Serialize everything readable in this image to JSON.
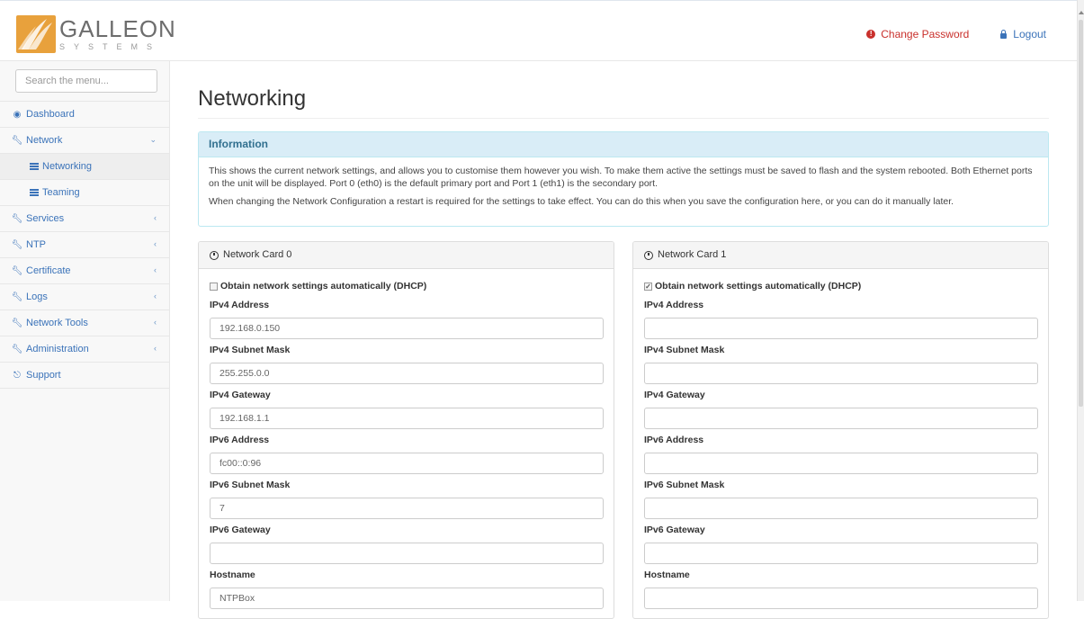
{
  "brand": {
    "name": "GALLEON",
    "sub": "SYSTEMS"
  },
  "header": {
    "change_password": "Change Password",
    "logout": "Logout"
  },
  "sidebar": {
    "search_placeholder": "Search the menu...",
    "items": [
      {
        "label": "Dashboard",
        "icon": "dashboard-icon"
      },
      {
        "label": "Network",
        "icon": "wrench-icon",
        "expanded": true
      },
      {
        "label": "Networking",
        "icon": "list-icon",
        "active": true
      },
      {
        "label": "Teaming",
        "icon": "list-icon"
      },
      {
        "label": "Services",
        "icon": "wrench-icon"
      },
      {
        "label": "NTP",
        "icon": "wrench-icon"
      },
      {
        "label": "Certificate",
        "icon": "wrench-icon"
      },
      {
        "label": "Logs",
        "icon": "wrench-icon"
      },
      {
        "label": "Network Tools",
        "icon": "wrench-icon"
      },
      {
        "label": "Administration",
        "icon": "wrench-icon"
      },
      {
        "label": "Support",
        "icon": "lifebuoy-icon"
      }
    ]
  },
  "main": {
    "title": "Networking",
    "info": {
      "heading": "Information",
      "p1": "This shows the current network settings, and allows you to customise them however you wish. To make them active the settings must be saved to flash and the system rebooted. Both Ethernet ports on the unit will be displayed. Port 0 (eth0) is the default primary port and Port 1 (eth1) is the secondary port.",
      "p2": "When changing the Network Configuration a restart is required for the settings to take effect. You can do this when you save the configuration here, or you can do it manually later."
    },
    "labels": {
      "dhcp": "Obtain network settings automatically (DHCP)",
      "ipv4_address": "IPv4 Address",
      "ipv4_subnet": "IPv4 Subnet Mask",
      "ipv4_gateway": "IPv4 Gateway",
      "ipv6_address": "IPv6 Address",
      "ipv6_subnet": "IPv6 Subnet Mask",
      "ipv6_gateway": "IPv6 Gateway",
      "hostname": "Hostname"
    },
    "cards": [
      {
        "title": "Network Card 0",
        "dhcp_checked": false,
        "ipv4_address": "192.168.0.150",
        "ipv4_subnet": "255.255.0.0",
        "ipv4_gateway": "192.168.1.1",
        "ipv6_address": "fc00::0:96",
        "ipv6_subnet": "7",
        "ipv6_gateway": "",
        "hostname": "NTPBox"
      },
      {
        "title": "Network Card 1",
        "dhcp_checked": true,
        "ipv4_address": "",
        "ipv4_subnet": "",
        "ipv4_gateway": "",
        "ipv6_address": "",
        "ipv6_subnet": "",
        "ipv6_gateway": "",
        "hostname": ""
      }
    ]
  },
  "colors": {
    "link": "#3b73b9",
    "danger": "#c9302c",
    "info_bg": "#d9edf7",
    "logo": "#e8a13c"
  }
}
